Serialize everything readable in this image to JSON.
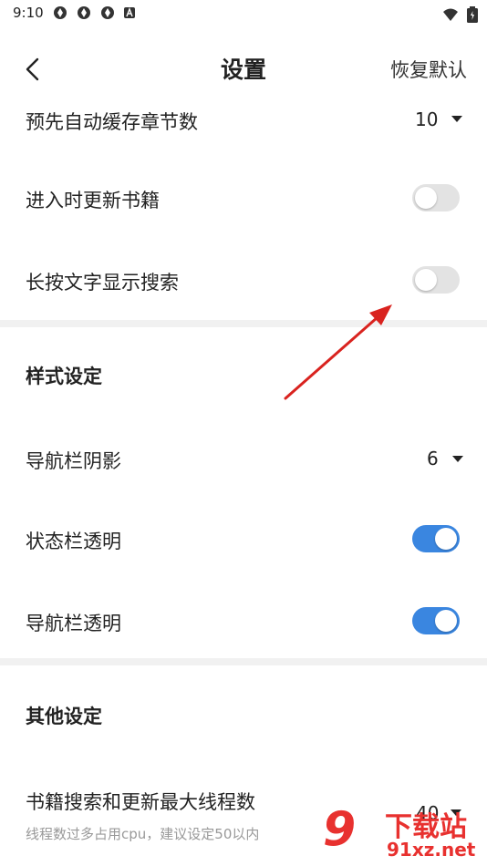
{
  "status_bar": {
    "time": "9:10",
    "icons": [
      "notification-icon",
      "notification-icon",
      "notification-icon",
      "a-icon",
      "wifi-icon",
      "battery-icon"
    ]
  },
  "header": {
    "title": "设置",
    "reset_label": "恢复默认"
  },
  "settings": {
    "prefetch_chapters": {
      "label": "预先自动缓存章节数",
      "value": "10"
    },
    "update_on_enter": {
      "label": "进入时更新书籍",
      "enabled": false
    },
    "longpress_search": {
      "label": "长按文字显示搜索",
      "enabled": false
    },
    "style_section": {
      "title": "样式设定"
    },
    "navbar_shadow": {
      "label": "导航栏阴影",
      "value": "6"
    },
    "statusbar_transparent": {
      "label": "状态栏透明",
      "enabled": true
    },
    "navbar_transparent": {
      "label": "导航栏透明",
      "enabled": true
    },
    "other_section": {
      "title": "其他设定"
    },
    "max_threads": {
      "label": "书籍搜索和更新最大线程数",
      "description": "线程数过多占用cpu，建议设定50以内",
      "value": "40"
    }
  },
  "watermark": {
    "logo": "9",
    "text": "下载站",
    "domain": "91xz.net"
  },
  "colors": {
    "accent": "#3a86e0",
    "toggle_off": "#e3e3e3",
    "arrow": "#d9231f",
    "watermark": "#e8312f"
  }
}
